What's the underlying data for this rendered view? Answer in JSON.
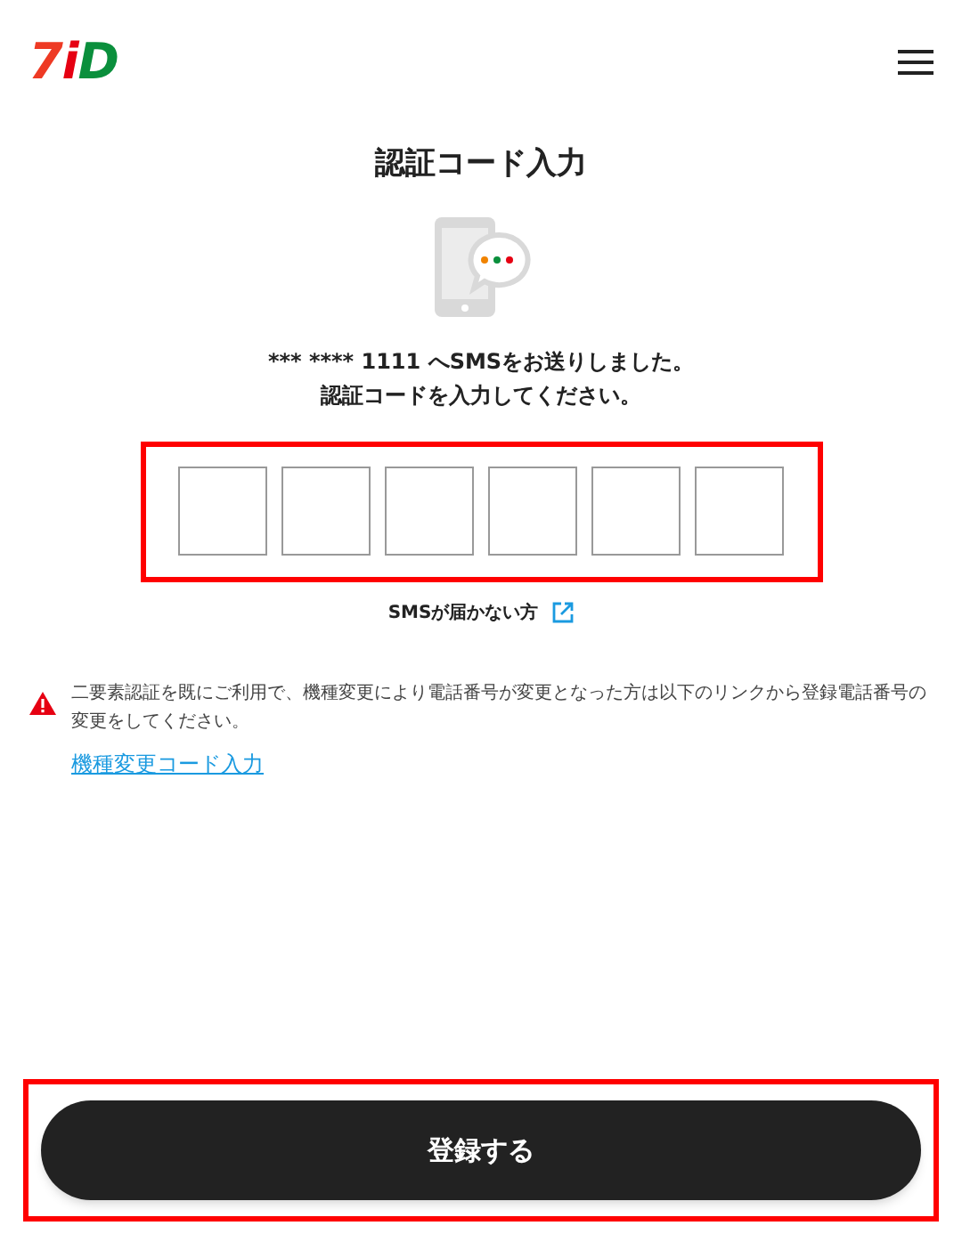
{
  "header": {
    "logo": "7iD"
  },
  "title": "認証コード入力",
  "message_lines": [
    "*** **** 1111 へSMSをお送りしました。",
    "認証コードを入力してください。"
  ],
  "code_fields": [
    {
      "kind": "digit"
    },
    {
      "kind": "digit"
    },
    {
      "kind": "digit"
    },
    {
      "kind": "digit"
    },
    {
      "kind": "digit"
    },
    {
      "kind": "digit"
    }
  ],
  "sms_help_link": "SMSが届かない方",
  "notice": {
    "text": "二要素認証を既にご利用で、機種変更により電話番号が変更となった方は以下のリンクから登録電話番号の変更をしてください。",
    "link": "機種変更コード入力"
  },
  "submit_button": "登録する"
}
